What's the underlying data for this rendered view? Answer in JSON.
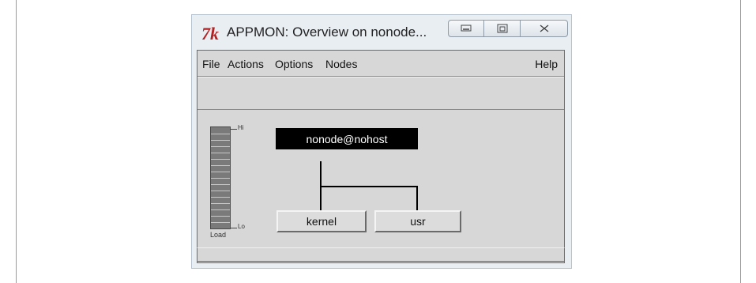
{
  "window": {
    "title": "APPMON: Overview on nonode...",
    "logo_text": "7k",
    "controls": {
      "minimize_icon": "minimize-icon",
      "maximize_icon": "maximize-icon",
      "close_icon": "close-icon"
    }
  },
  "menubar": {
    "items": [
      {
        "label": "File"
      },
      {
        "label": "Actions"
      },
      {
        "label": "Options"
      },
      {
        "label": "Nodes"
      }
    ],
    "help_label": "Help"
  },
  "load_meter": {
    "label": "Load",
    "high_label": "Hi",
    "low_label": "Lo"
  },
  "tree": {
    "root_node": "nonode@nohost",
    "applications": [
      {
        "label": "kernel"
      },
      {
        "label": "usr"
      }
    ]
  },
  "colors": {
    "client_bg": "#d7d7d7",
    "node_bg": "#000000",
    "logo": "#b22222"
  }
}
